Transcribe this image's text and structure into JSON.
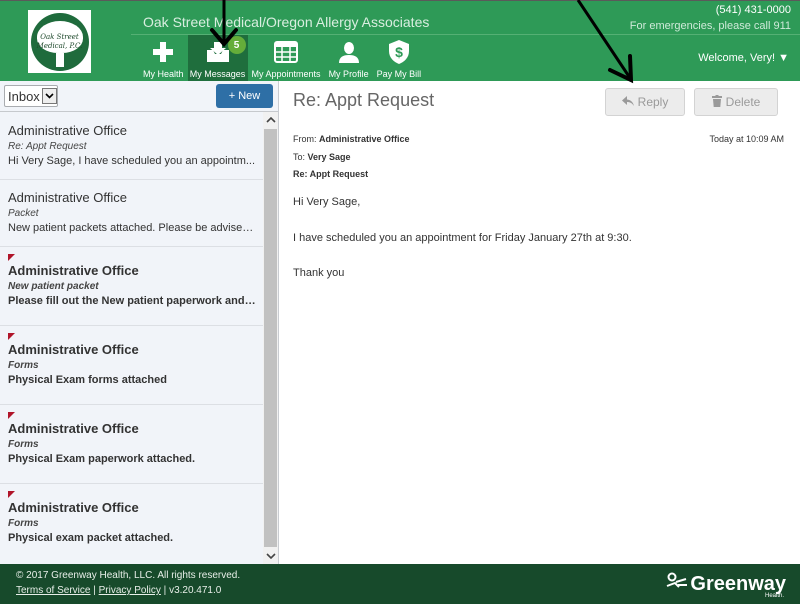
{
  "header": {
    "logo_text_line1": "Oak Street",
    "logo_text_line2": "Medical, P.C.",
    "site_title": "Oak Street Medical/Oregon Allergy Associates",
    "phone": "(541) 431-0000",
    "emergency": "For emergencies, please call 911",
    "welcome": "Welcome, Very! ▼",
    "nav": [
      {
        "label": "My Health",
        "icon": "plus-icon"
      },
      {
        "label": "My Messages",
        "icon": "inbox-icon",
        "badge": "5",
        "active": true
      },
      {
        "label": "My Appointments",
        "icon": "calendar-grid-icon"
      },
      {
        "label": "My Profile",
        "icon": "person-icon"
      },
      {
        "label": "Pay My Bill",
        "icon": "dollar-shield-icon"
      }
    ]
  },
  "inbox": {
    "folder": "Inbox",
    "new_label": "+ New",
    "messages": [
      {
        "from": "Administrative Office",
        "subject": "Re: Appt Request",
        "preview": "Hi Very Sage, I have scheduled you an appointm...",
        "unread": false
      },
      {
        "from": "Administrative Office",
        "subject": "Packet",
        "preview": "New patient packets attached. Please be advised t...",
        "unread": false
      },
      {
        "from": "Administrative Office",
        "subject": "New patient packet",
        "preview": "Please fill out the New patient paperwork and bri...",
        "unread": true
      },
      {
        "from": "Administrative Office",
        "subject": "Forms",
        "preview": "Physical Exam forms attached",
        "unread": true
      },
      {
        "from": "Administrative Office",
        "subject": "Forms",
        "preview": "Physical Exam paperwork attached.",
        "unread": true
      },
      {
        "from": "Administrative Office",
        "subject": "Forms",
        "preview": "Physical exam packet attached.",
        "unread": true
      }
    ]
  },
  "message": {
    "subject": "Re: Appt Request",
    "reply_label": "Reply",
    "delete_label": "Delete",
    "from_label": "From:",
    "from": "Administrative Office",
    "to_label": "To:",
    "to": "Very Sage",
    "re": "Re: Appt Request",
    "date": "Today at 10:09 AM",
    "body": [
      "Hi Very Sage,",
      "I have scheduled you an appointment for Friday January 27th at 9:30.",
      "Thank you"
    ]
  },
  "footer": {
    "copyright": "© 2017 Greenway Health, LLC. All rights reserved.",
    "terms": "Terms of Service",
    "privacy": "Privacy Policy",
    "version": "v3.20.471.0",
    "brand": "Greenway",
    "brand_sub": "Health."
  },
  "colors": {
    "header_green": "#2e9a57",
    "active_nav": "#1f6e3d",
    "footer_green": "#174a2b",
    "new_button": "#2e6fa6",
    "unread_flag": "#b0152a"
  }
}
